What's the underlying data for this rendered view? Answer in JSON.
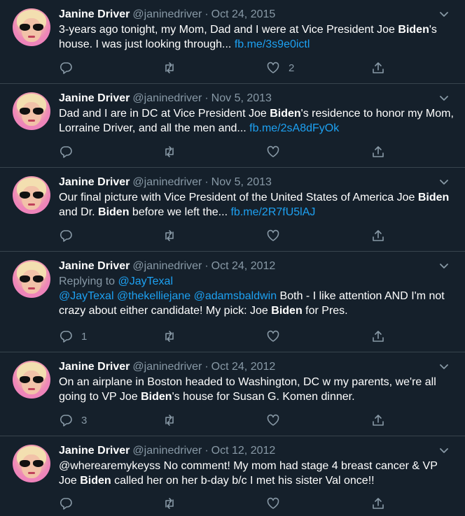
{
  "user": {
    "name": "Janine Driver",
    "handle": "@janinedriver",
    "separator": "·"
  },
  "colors": {
    "background": "#15202b",
    "link": "#1da1f2",
    "muted": "#8899a6",
    "divider": "#38444d"
  },
  "tweets": [
    {
      "date": "Oct 24, 2015",
      "text_a": "3-years ago tonight, my Mom, Dad and I were at Vice President Joe ",
      "bold_a": "Biden",
      "text_b": "'s house. I was just looking through... ",
      "link": "fb.me/3s9e0ictl",
      "likes": "2"
    },
    {
      "date": "Nov 5, 2013",
      "text_a": "Dad and I are in DC at Vice President Joe ",
      "bold_a": "Biden",
      "text_b": "'s residence to honor my Mom, Lorraine Driver, and all the men and... ",
      "link": "fb.me/2sA8dFyOk"
    },
    {
      "date": "Nov 5, 2013",
      "text_a": "Our final picture with Vice President of the United States of America Joe ",
      "bold_a": "Biden",
      "text_b": " and Dr. ",
      "bold_b": "Biden",
      "text_c": " before we left the... ",
      "link": "fb.me/2R7fU5lAJ"
    },
    {
      "date": "Oct 24, 2012",
      "replying_label": "Replying to ",
      "replying_to": "@JayTexal",
      "mentions": "@JayTexal @thekelliejane @adamsbaldwin",
      "text_a": " Both - I like attention AND I'm not crazy about either candidate!  My pick: Joe ",
      "bold_a": "Biden",
      "text_b": " for Pres.",
      "replies": "1"
    },
    {
      "date": "Oct 24, 2012",
      "text_a": "On an airplane in Boston headed to Washington, DC w my parents, we're all going to VP Joe ",
      "bold_a": "Biden",
      "text_b": "'s house for Susan G. Komen dinner.",
      "replies": "3"
    },
    {
      "date": "Oct 12, 2012",
      "text_a": "@wherearemykeyss No comment! My mom had stage 4 breast cancer & VP Joe ",
      "bold_a": "Biden",
      "text_b": " called her on her b-day b/c I met his sister Val once!!"
    }
  ]
}
